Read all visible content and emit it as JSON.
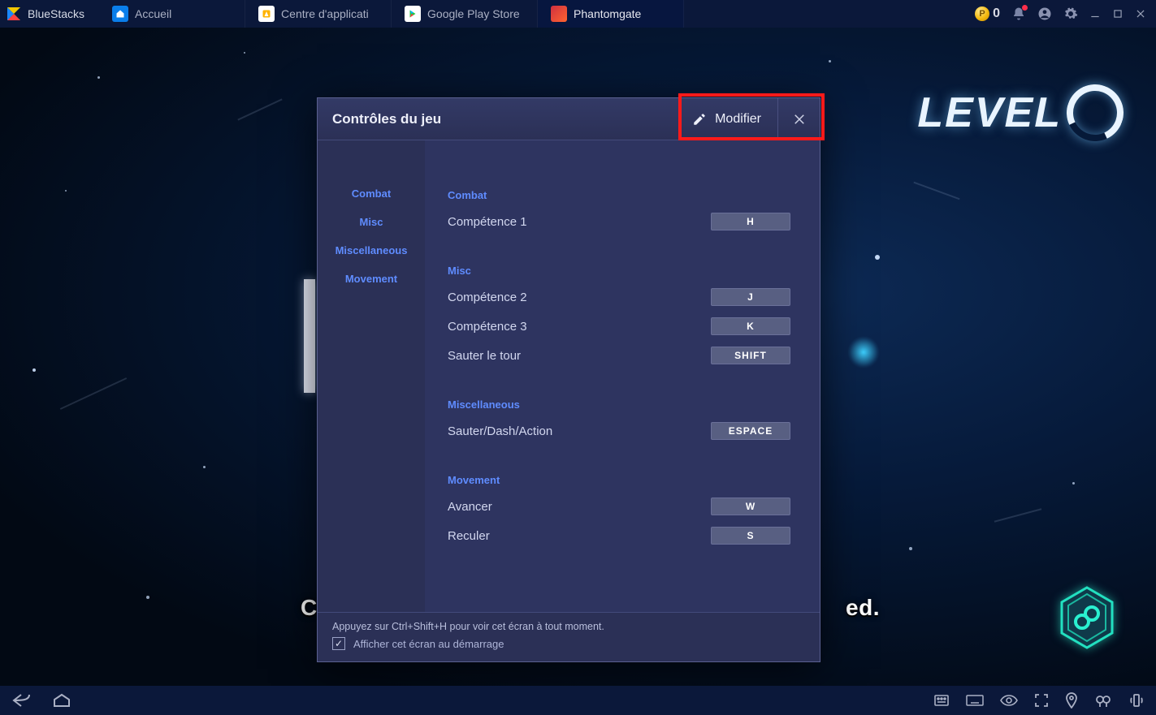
{
  "app_name": "BlueStacks",
  "coin_amount": "0",
  "tabs": [
    {
      "label": "Accueil"
    },
    {
      "label": "Centre d'applicati"
    },
    {
      "label": "Google Play Store"
    },
    {
      "label": "Phantomgate"
    }
  ],
  "level_label": "LEVEL",
  "stub": {
    "left": "Co",
    "right": "ed."
  },
  "modal": {
    "title": "Contrôles du jeu",
    "modify": "Modifier",
    "nav": [
      "Combat",
      "Misc",
      "Miscellaneous",
      "Movement"
    ],
    "sections": [
      {
        "title": "Combat",
        "rows": [
          {
            "label": "Compétence 1",
            "key": "H"
          }
        ]
      },
      {
        "title": "Misc",
        "rows": [
          {
            "label": "Compétence 2",
            "key": "J"
          },
          {
            "label": "Compétence 3",
            "key": "K"
          },
          {
            "label": "Sauter le tour",
            "key": "SHIFT"
          }
        ]
      },
      {
        "title": "Miscellaneous",
        "rows": [
          {
            "label": "Sauter/Dash/Action",
            "key": "ESPACE"
          }
        ]
      },
      {
        "title": "Movement",
        "rows": [
          {
            "label": "Avancer",
            "key": "W"
          },
          {
            "label": "Reculer",
            "key": "S"
          }
        ]
      }
    ],
    "footer_hint": "Appuyez sur Ctrl+Shift+H pour voir cet écran à tout moment.",
    "footer_checkbox": "Afficher cet écran au démarrage"
  }
}
